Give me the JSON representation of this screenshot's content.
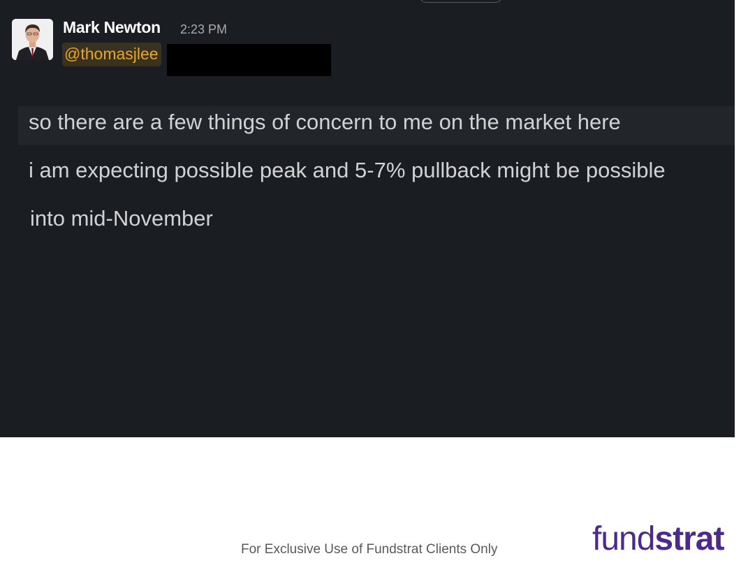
{
  "message": {
    "author": "Mark Newton",
    "timestamp": "2:23 PM",
    "mention": "@thomasjlee",
    "lines": [
      "so there are a few things of concern to me on the market here",
      "i am expecting possible peak and 5-7% pullback might be possible",
      "into mid-November"
    ]
  },
  "footer": {
    "disclaimer": "For Exclusive Use of Fundstrat Clients Only",
    "logo_part1": "fund",
    "logo_part2": "strat"
  },
  "colors": {
    "chat_background": "#1a1d21",
    "mention_text": "#e8a723",
    "brand": "#4b2a8c"
  }
}
